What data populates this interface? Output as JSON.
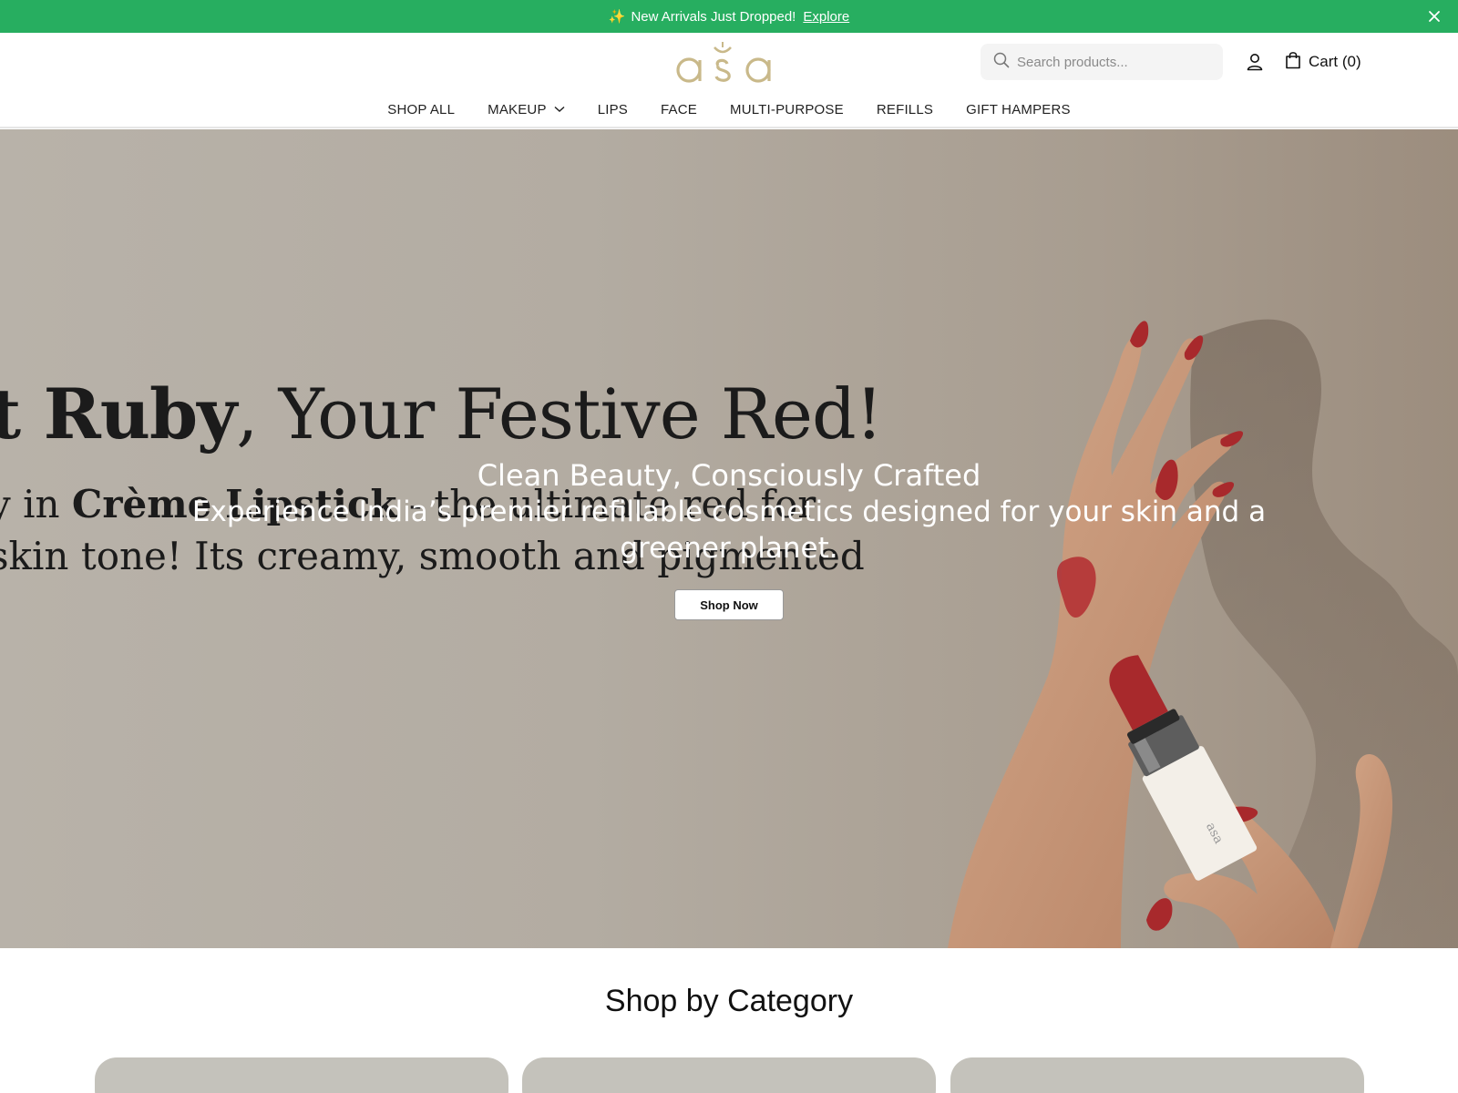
{
  "announcement": {
    "text": "New Arrivals Just Dropped!",
    "link": "Explore",
    "sparkle": "✨"
  },
  "header": {
    "logo_text": "asa",
    "search_placeholder": "Search products...",
    "cart_label": "Cart (0)",
    "icons": {
      "search": "search-icon",
      "user": "user-icon",
      "cart": "shopping-bag-icon",
      "close": "close-icon",
      "chevron": "chevron-down-icon"
    }
  },
  "nav": {
    "items": [
      "SHOP ALL",
      "MAKEUP",
      "LIPS",
      "FACE",
      "MULTI-PURPOSE",
      "REFILLS",
      "GIFT HAMPERS"
    ]
  },
  "hero": {
    "image_line1_bold": "t Ruby",
    "image_line1_rest": ", Your Festive Red!",
    "image_line2_pre": "y in ",
    "image_line2_bold": "Crème Lipstick",
    "image_line2_rest": " - the ultimate red for",
    "image_line3": "skin tone! Its creamy, smooth and pigmented",
    "title": "Clean Beauty, Consciously Crafted",
    "subtitle": "Experience India’s premier refillable cosmetics designed for your skin and a greener planet.",
    "button": "Shop Now"
  },
  "category": {
    "title": "Shop by Category"
  },
  "colors": {
    "announce_bg": "#27ae60",
    "logo_gold": "#c9b98a",
    "nail_red": "#a8292c"
  }
}
